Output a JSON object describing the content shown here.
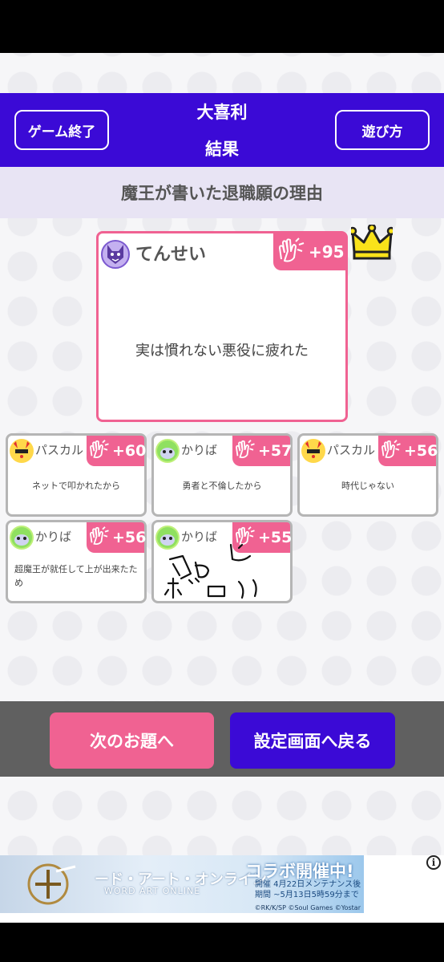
{
  "header": {
    "end_game_label": "ゲーム終了",
    "how_to_play_label": "遊び方",
    "title_line1": "大喜利",
    "title_line2": "結果"
  },
  "prompt": "魔王が書いた退職願の理由",
  "winner": {
    "name": "てんせい",
    "score": "+95",
    "answer": "実は慣れない悪役に疲れた"
  },
  "cards": [
    {
      "name": "パスカル",
      "score": "+60",
      "answer": "ネットで叩かれたから"
    },
    {
      "name": "かりば",
      "score": "+57",
      "answer": "勇者と不倫したから"
    },
    {
      "name": "パスカル",
      "score": "+56",
      "answer": "時代じゃない"
    },
    {
      "name": "かりば",
      "score": "+56",
      "answer": "超魔王が就任して上が出来たため"
    },
    {
      "name": "かりば",
      "score": "+55",
      "answer": ""
    }
  ],
  "buttons": {
    "next_label": "次のお題へ",
    "back_label": "設定画面へ戻る"
  },
  "ad": {
    "title": "ード・アート・オンライン",
    "subtitle": "WORD ART ONLINE",
    "collab": "コラボ開催中!",
    "detail_line1": "開催 4月22日メンテナンス後",
    "detail_line2": "期間 ~5月13日5時59分まで",
    "credit": "©RK/K/SP ©Soul Games ©Yostar",
    "info": "i"
  },
  "colors": {
    "header": "#3b0ad6",
    "accent_pink": "#f06292",
    "prompt_bg": "#e8e4f4",
    "bottom_panel": "#606060"
  },
  "icons": {
    "clap": "clapping-hands-icon",
    "crown": "crown-icon"
  }
}
